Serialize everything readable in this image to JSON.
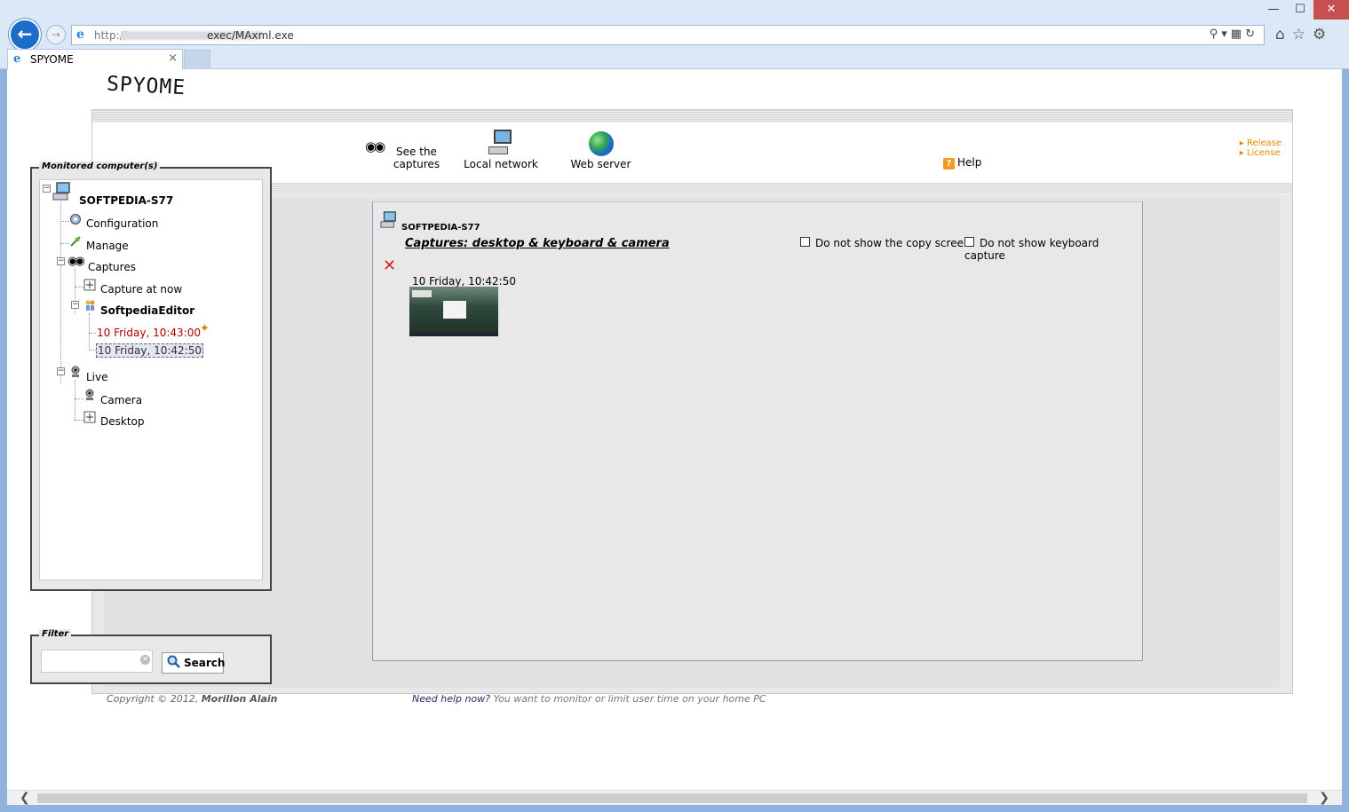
{
  "window": {
    "minimize": "—",
    "maximize": "☐",
    "close": "✕"
  },
  "browser": {
    "url_scheme": "http://",
    "url_path": "exec/MAxml.exe",
    "tab_title": "SPYOME",
    "tab_close": "×"
  },
  "logo_text": "SPYOME",
  "header": {
    "nav": {
      "captures": [
        "See the",
        "captures"
      ],
      "local_network": "Local network",
      "web_server": "Web server",
      "help": "Help"
    },
    "links": [
      "Release",
      "License"
    ]
  },
  "sidebar": {
    "monitored_legend": "Monitored computer(s)",
    "tree": {
      "computer": "SOFTPEDIA-S77",
      "configuration": "Configuration",
      "manage": "Manage",
      "captures": "Captures",
      "capture_now": "Capture at now",
      "user": "SoftpediaEditor",
      "capture_items": [
        "10 Friday, 10:43:00",
        "10 Friday, 10:42:50"
      ],
      "live": "Live",
      "camera": "Camera",
      "desktop": "Desktop"
    },
    "filter_legend": "Filter",
    "filter_value": "",
    "search_label": "Search"
  },
  "panel": {
    "host": "SOFTPEDIA-S77",
    "caption": "Captures: desktop & keyboard & camera",
    "option_copy_screen": "Do not show the copy screen",
    "option_keyboard": "Do not show keyboard capture",
    "option_copy_screen_checked": false,
    "option_keyboard_checked": false,
    "screenshot_time": "10 Friday, 10:42:50"
  },
  "footer": {
    "copyright_prefix": "Copyright © 2012,",
    "author": "Morillon Alain",
    "help_question": "Need help now?",
    "help_text": "You want to monitor or limit user time on your home PC"
  },
  "colors": {
    "accent": "#1c6dc9",
    "link_orange": "#e38b00",
    "recent_capture": "#b00000",
    "delete_red": "#d62020"
  }
}
